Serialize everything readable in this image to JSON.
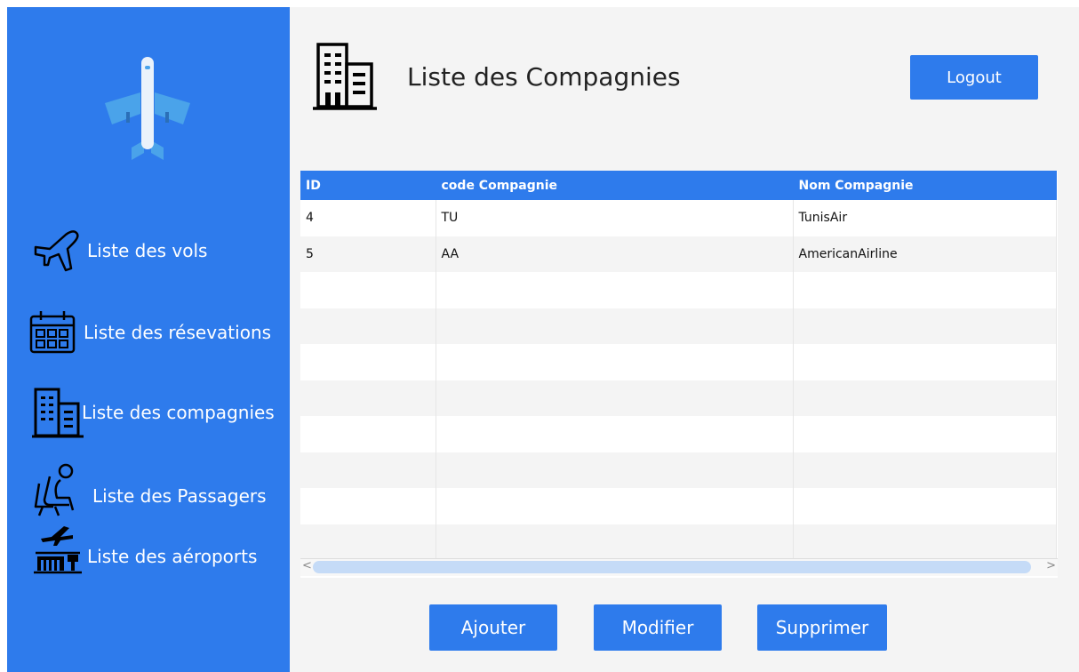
{
  "sidebar": {
    "items": [
      {
        "label": "Liste des vols",
        "icon": "airplane-icon"
      },
      {
        "label": "Liste des résevations",
        "icon": "calendar-icon"
      },
      {
        "label": "Liste des compagnies",
        "icon": "building-icon"
      },
      {
        "label": "Liste des Passagers",
        "icon": "passenger-seat-icon"
      },
      {
        "label": "Liste des aéroports",
        "icon": "airport-icon"
      }
    ]
  },
  "header": {
    "title": "Liste des Compagnies",
    "logout_label": "Logout"
  },
  "table": {
    "columns": [
      "ID",
      "code Compagnie",
      "Nom Compagnie"
    ],
    "rows": [
      [
        "4",
        "TU",
        "TunisAir"
      ],
      [
        "5",
        "AA",
        "AmericanAirline"
      ]
    ]
  },
  "actions": {
    "add_label": "Ajouter",
    "edit_label": "Modifier",
    "delete_label": "Supprimer"
  },
  "colors": {
    "accent": "#2e7bec",
    "background": "#f4f4f4"
  }
}
